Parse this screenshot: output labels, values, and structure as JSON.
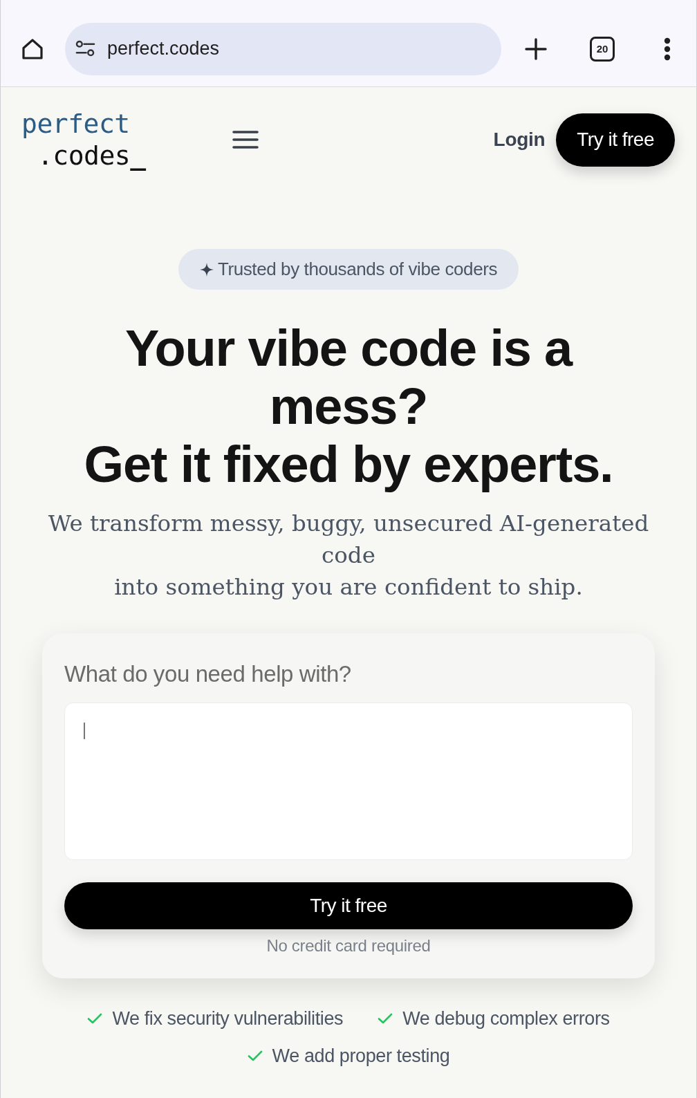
{
  "browser": {
    "url": "perfect.codes",
    "tab_count": "20"
  },
  "header": {
    "logo": {
      "line_1": "perfect",
      "line_2": ".codes",
      "cursor": "_"
    },
    "login": "Login",
    "cta": "Try it free"
  },
  "hero": {
    "badge": "Trusted by thousands of vibe coders",
    "headline_lines": [
      "Your vibe code is a mess?",
      "Get it fixed by experts."
    ],
    "subtitle_lines": [
      "We transform messy, buggy, unsecured AI-generated code",
      "into something you are confident to ship."
    ]
  },
  "form": {
    "label": "What do you need help with?",
    "field": {
      "focused": true
    },
    "submit": "Try it free",
    "note": "No credit card required"
  },
  "features": [
    {
      "text": "We fix security vulnerabilities"
    },
    {
      "text": "We debug complex errors"
    },
    {
      "text": "We add proper testing"
    }
  ]
}
